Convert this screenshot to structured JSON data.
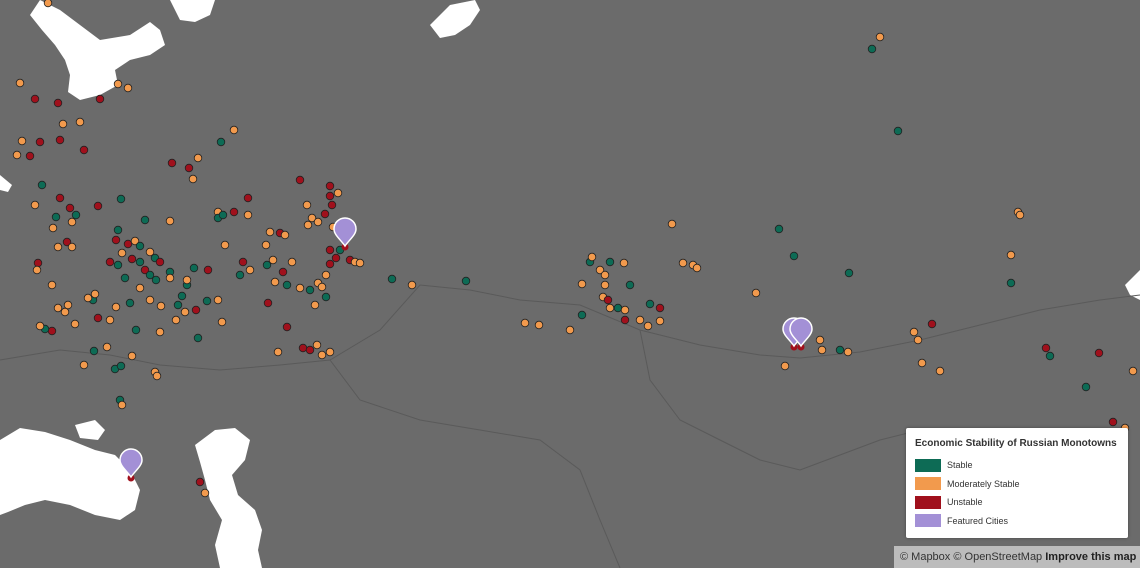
{
  "map": {
    "colors": {
      "land": "#6b6b6b",
      "water": "#ffffff",
      "border": "#5a5a5a",
      "stable": "#0d6b55",
      "moderate": "#f29a4d",
      "unstable": "#a0101c",
      "featured": "#a390d6"
    },
    "featured_cities": [
      {
        "marker": "featured-city-marker",
        "icon": "map-pin-icon"
      },
      {
        "marker": "featured-city-marker",
        "icon": "map-pin-icon"
      },
      {
        "marker": "featured-city-marker",
        "icon": "map-pin-icon"
      },
      {
        "marker": "featured-city-marker",
        "icon": "map-pin-icon"
      }
    ]
  },
  "legend": {
    "title": "Economic Stability of Russian Monotowns",
    "items": [
      {
        "label": "Stable",
        "color": "#0d6b55"
      },
      {
        "label": "Moderately Stable",
        "color": "#f29a4d"
      },
      {
        "label": "Unstable",
        "color": "#a0101c"
      },
      {
        "label": "Featured Cities",
        "color": "#a390d6"
      }
    ]
  },
  "attribution": {
    "mapbox": "© Mapbox",
    "osm": "© OpenStreetMap",
    "improve": "Improve this map"
  }
}
